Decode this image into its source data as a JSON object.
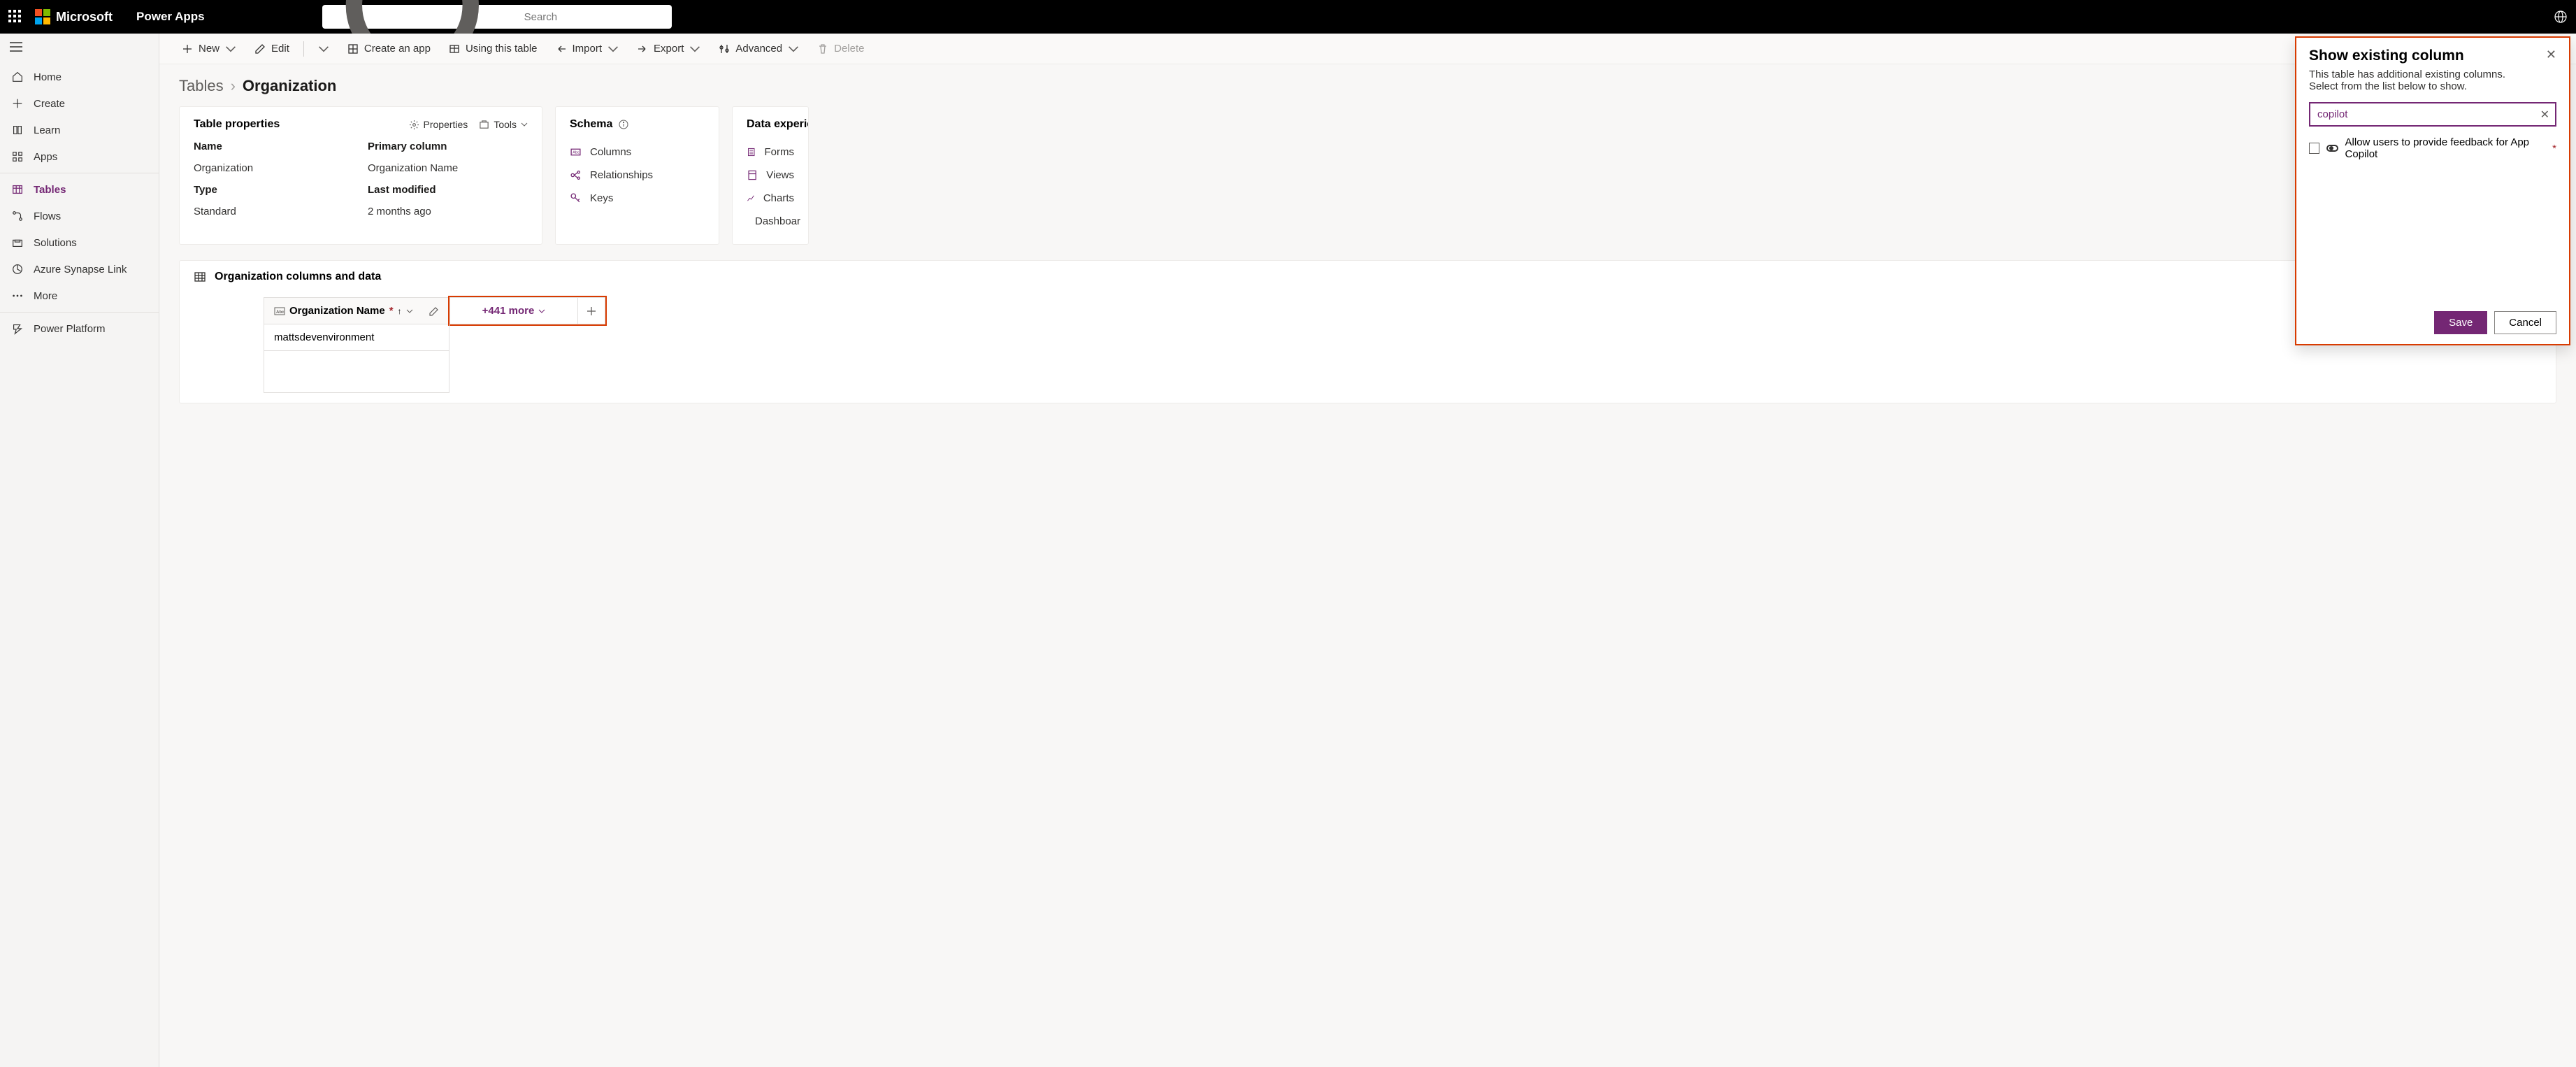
{
  "header": {
    "brand": "Microsoft",
    "app_name": "Power Apps",
    "search_placeholder": "Search"
  },
  "nav": {
    "items": [
      {
        "label": "Home"
      },
      {
        "label": "Create"
      },
      {
        "label": "Learn"
      },
      {
        "label": "Apps"
      },
      {
        "label": "Tables"
      },
      {
        "label": "Flows"
      },
      {
        "label": "Solutions"
      },
      {
        "label": "Azure Synapse Link"
      },
      {
        "label": "More"
      },
      {
        "label": "Power Platform"
      }
    ]
  },
  "cmdbar": {
    "new": "New",
    "edit": "Edit",
    "create_app": "Create an app",
    "using_table": "Using this table",
    "import": "Import",
    "export": "Export",
    "advanced": "Advanced",
    "delete": "Delete"
  },
  "breadcrumb": {
    "root": "Tables",
    "current": "Organization"
  },
  "tableprops": {
    "title": "Table properties",
    "properties_btn": "Properties",
    "tools_btn": "Tools",
    "name_lbl": "Name",
    "name_val": "Organization",
    "pcol_lbl": "Primary column",
    "pcol_val": "Organization Name",
    "type_lbl": "Type",
    "type_val": "Standard",
    "lm_lbl": "Last modified",
    "lm_val": "2 months ago"
  },
  "schema": {
    "title": "Schema",
    "columns": "Columns",
    "relationships": "Relationships",
    "keys": "Keys"
  },
  "dataexp": {
    "title": "Data experien",
    "forms": "Forms",
    "views": "Views",
    "charts": "Charts",
    "dashboards": "Dashboar"
  },
  "datacard": {
    "title": "Organization columns and data",
    "col_name": "Organization Name",
    "more_count": "+441 more",
    "row1": "mattsdevenvironment"
  },
  "panel": {
    "title": "Show existing column",
    "desc1": "This table has additional existing columns.",
    "desc2": "Select from the list below to show.",
    "search_value": "copilot",
    "item1": "Allow users to provide feedback for App Copilot",
    "save": "Save",
    "cancel": "Cancel"
  }
}
